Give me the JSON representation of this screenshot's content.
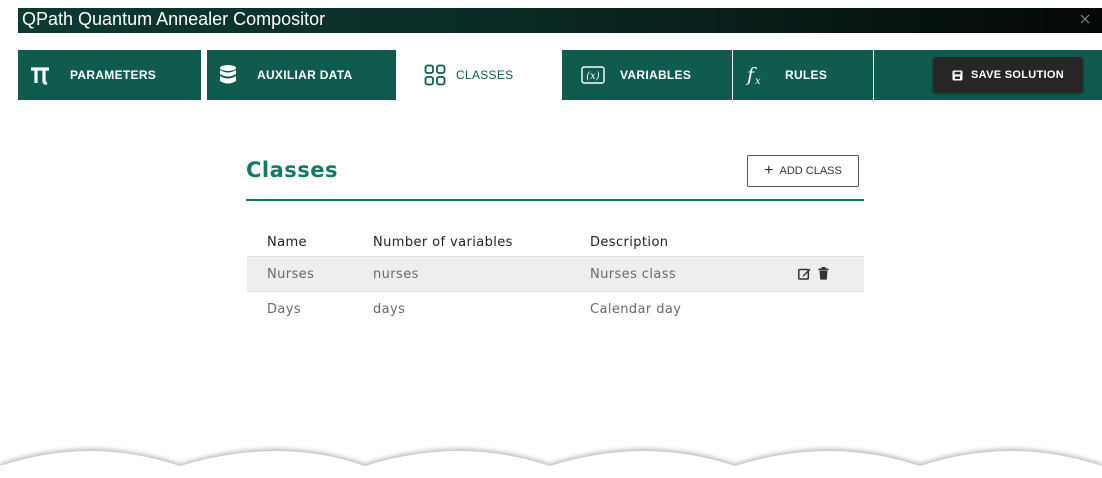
{
  "window": {
    "title": "QPath Quantum Annealer Compositor"
  },
  "tabs": [
    {
      "id": "parameters",
      "label": "PARAMETERS",
      "icon": "pi-icon"
    },
    {
      "id": "auxiliar",
      "label": "AUXILIAR DATA",
      "icon": "database-icon"
    },
    {
      "id": "classes",
      "label": "CLASSES",
      "icon": "grid-icon",
      "active": true
    },
    {
      "id": "variables",
      "label": "VARIABLES",
      "icon": "variable-icon"
    },
    {
      "id": "rules",
      "label": "RULES",
      "icon": "function-icon"
    }
  ],
  "toolbar": {
    "save_label": "SAVE SOLUTION"
  },
  "main": {
    "heading": "Classes",
    "add_label": "ADD CLASS",
    "table": {
      "headers": [
        "Name",
        "Number of variables",
        "Description"
      ],
      "rows": [
        {
          "name": "Nurses",
          "variables": "nurses",
          "description": "Nurses class"
        },
        {
          "name": "Days",
          "variables": "days",
          "description": "Calendar day"
        }
      ]
    }
  },
  "colors": {
    "accent": "#0f5c4e",
    "heading": "#0f7a66",
    "save_button": "#262626"
  }
}
